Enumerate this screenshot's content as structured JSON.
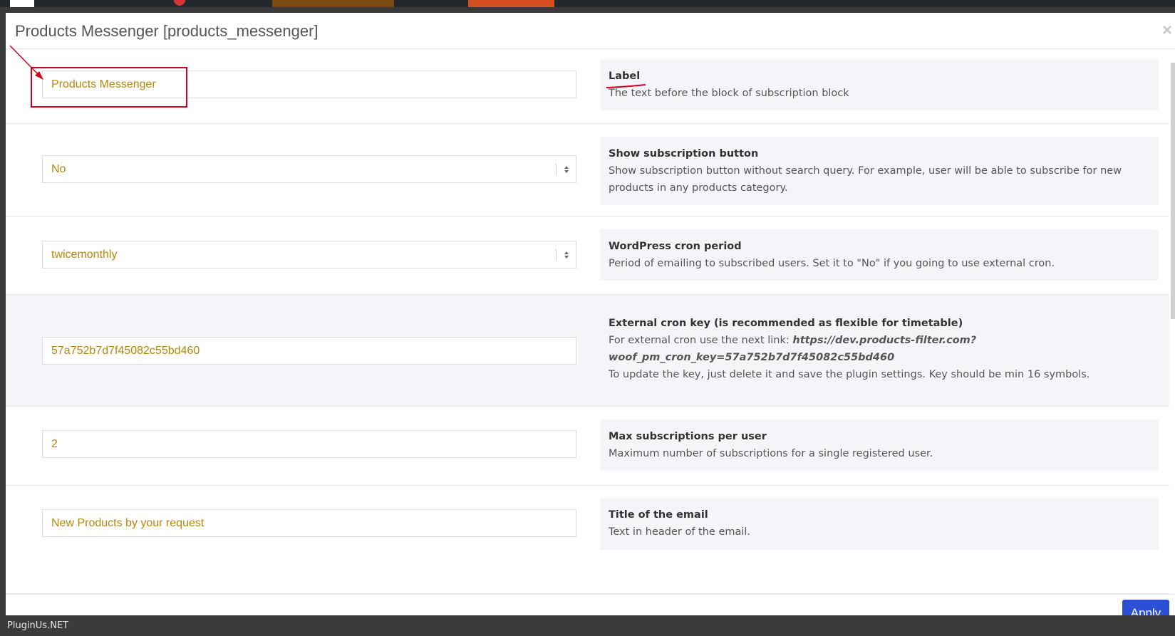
{
  "modal": {
    "title": "Products Messenger [products_messenger]",
    "close_glyph": "×"
  },
  "rows": [
    {
      "value": "Products Messenger",
      "title": "Label",
      "text": "The text before the block of subscription block"
    },
    {
      "value": "No",
      "title": "Show subscription button",
      "text": "Show subscription button without search query. For example, user will be able to subscribe for new products in any products category."
    },
    {
      "value": "twicemonthly",
      "title": "WordPress cron period",
      "text": "Period of emailing to subscribed users. Set it to \"No\" if you going to use external cron."
    },
    {
      "value": "57a752b7d7f45082c55bd460",
      "title": "External cron key (is recommended as flexible for timetable)",
      "text_prefix": "For external cron use the next link: ",
      "link": "https://dev.products-filter.com?woof_pm_cron_key=57a752b7d7f45082c55bd460",
      "text_suffix": "To update the key, just delete it and save the plugin settings. Key should be min 16 symbols."
    },
    {
      "value": "2",
      "title": "Max subscriptions per user",
      "text": "Maximum number of subscriptions for a single registered user."
    },
    {
      "value": "New Products by your request",
      "title": "Title of the email",
      "text": "Text in header of the email."
    }
  ],
  "footer": {
    "apply_label": "Apply"
  },
  "statusbar": {
    "text": "PluginUs.NET"
  },
  "colors": {
    "accent": "#2b50d6",
    "field_text": "#b8860b",
    "annotation": "#d0021b"
  }
}
